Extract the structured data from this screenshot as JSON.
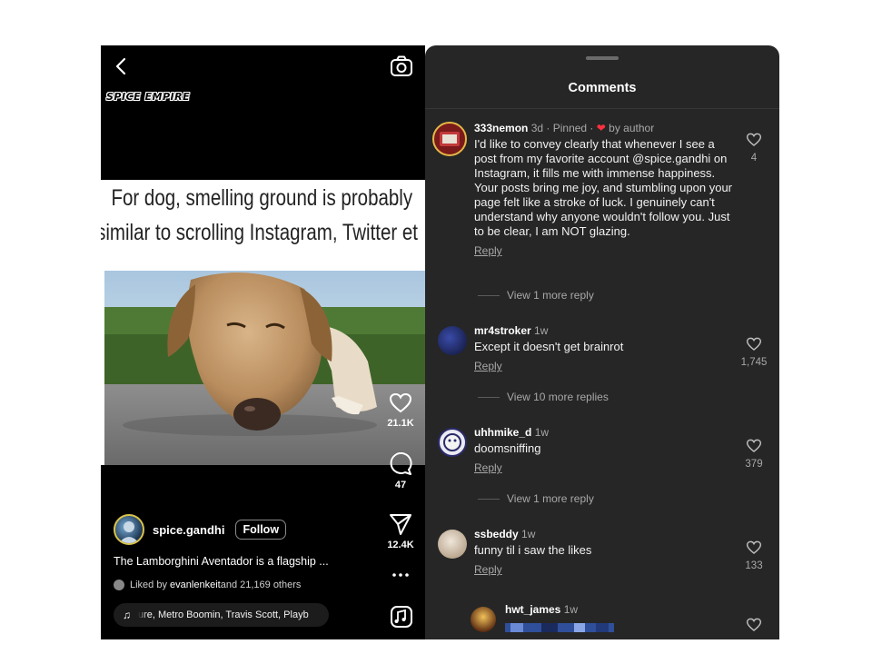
{
  "reel": {
    "brand": "SPICE EMPIRE",
    "meme_line1": "For dog, smelling ground is probably",
    "meme_line2": "similar to scrolling Instagram, Twitter et",
    "likes": "21.1K",
    "comments": "47",
    "shares": "12.4K",
    "author": "spice.gandhi",
    "follow_label": "Follow",
    "caption": "The Lamborghini Aventador is a flagship ...",
    "liked_by_prefix": "Liked by ",
    "liked_by_user": "evanlenkeit",
    "liked_by_suffix": " and 21,169 others",
    "music": "ure, Metro Boomin, Travis Scott, Playb",
    "more_icon": "more-horizontal-icon"
  },
  "comments_panel": {
    "title": "Comments",
    "reply_label": "Reply",
    "items": [
      {
        "user": "333nemon",
        "time": "3d",
        "pinned": " · Pinned · ",
        "by_author": "by author",
        "text": "I'd like to convey clearly that whenever I see a post from my favorite account @spice.gandhi on Instagram, it fills me with immense happiness. Your posts bring me joy, and stumbling upon your page felt like a stroke of luck. I genuinely can't understand why anyone wouldn't follow you. Just to be clear, I am NOT glazing.",
        "likes": "4",
        "more_replies": "View 1 more reply"
      },
      {
        "user": "mr4stroker",
        "time": "1w",
        "text": "Except it doesn't get brainrot",
        "likes": "1,745",
        "more_replies": "View 10 more replies"
      },
      {
        "user": "uhhmike_d",
        "time": "1w",
        "text": "doomsniffing",
        "likes": "379",
        "more_replies": "View 1 more reply"
      },
      {
        "user": "ssbeddy",
        "time": "1w",
        "text": "funny til i saw the likes",
        "likes": "133"
      },
      {
        "user": "hwt_james",
        "time": "1w"
      }
    ]
  },
  "colors": {
    "panel_bg": "#262626",
    "accent_heart": "#ff3040",
    "reel_bg": "#000000"
  }
}
